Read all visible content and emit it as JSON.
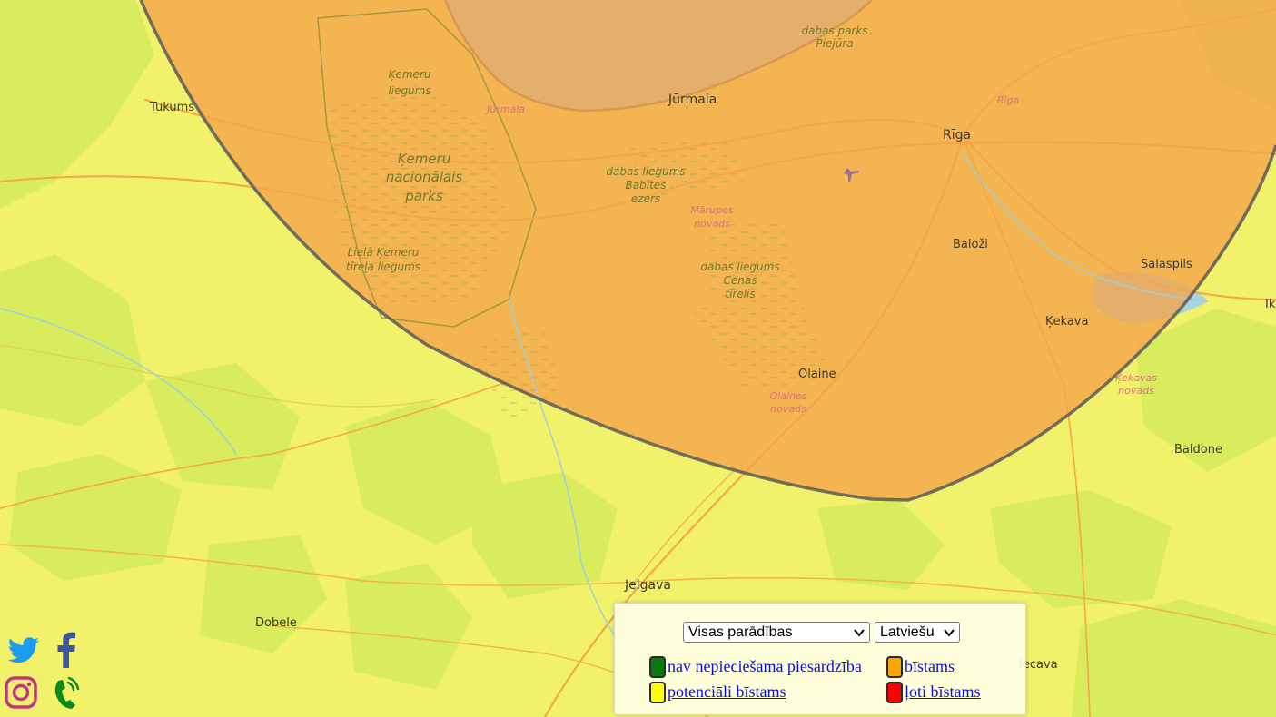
{
  "map": {
    "places": {
      "tukums": "Tukums",
      "jurmala": "Jūrmala",
      "riga": "Rīga",
      "balozi": "Baloži",
      "salaspils": "Salaspils",
      "kekava": "Ķekava",
      "olaine": "Olaine",
      "baldone": "Baldone",
      "jelgava": "Jelgava",
      "dobele": "Dobele",
      "iecava": "Iecava",
      "ik": "Ik"
    },
    "park_labels": {
      "kemeru_liegums_1": "Ķemeru",
      "kemeru_liegums_2": "liegums",
      "kemeru_np_1": "Ķemeru",
      "kemeru_np_2": "nacionālais",
      "kemeru_np_3": "parks",
      "liela_kemeru_1": "Lielā Ķemeru",
      "liela_kemeru_2": "tīreļa liegums",
      "babites_1": "dabas liegums",
      "babites_2": "Babītes",
      "babites_3": "ezers",
      "cenas_1": "dabas liegums",
      "cenas_2": "Cenas",
      "cenas_3": "tīrelis",
      "piejura_1": "dabas parks",
      "piejura_2": "Piejūra"
    },
    "municipality_labels": {
      "jurmala": "Jūrmala",
      "riga": "Rīga",
      "marupes_1": "Mārupes",
      "marupes_2": "novads",
      "olaines_1": "Olaines",
      "olaines_2": "novads",
      "kekavas_1": "Ķekavas",
      "kekavas_2": "novads"
    },
    "colors": {
      "base_yellow": "#f2f26a",
      "forest_green": "#d8ec5e",
      "warning_orange": "#f5a34a",
      "sea": "#a8d4e0",
      "zone_border": "#5b5b5b"
    }
  },
  "social": {
    "twitter_color": "#1d9bf0",
    "facebook_color": "#3b5998",
    "instagram_color": "#c13584",
    "phone_color": "#0a8a1a"
  },
  "controls": {
    "phenomena_selected": "Visas parādības",
    "language_selected": "Latviešu"
  },
  "legend": {
    "items": [
      {
        "label": "nav nepieciešama piesardzība",
        "color": "#0a7a10"
      },
      {
        "label": "bīstams",
        "color": "#ffa500"
      },
      {
        "label": "potenciāli bīstams",
        "color": "#ffff00"
      },
      {
        "label": "ļoti bīstams",
        "color": "#ff0000"
      }
    ]
  }
}
